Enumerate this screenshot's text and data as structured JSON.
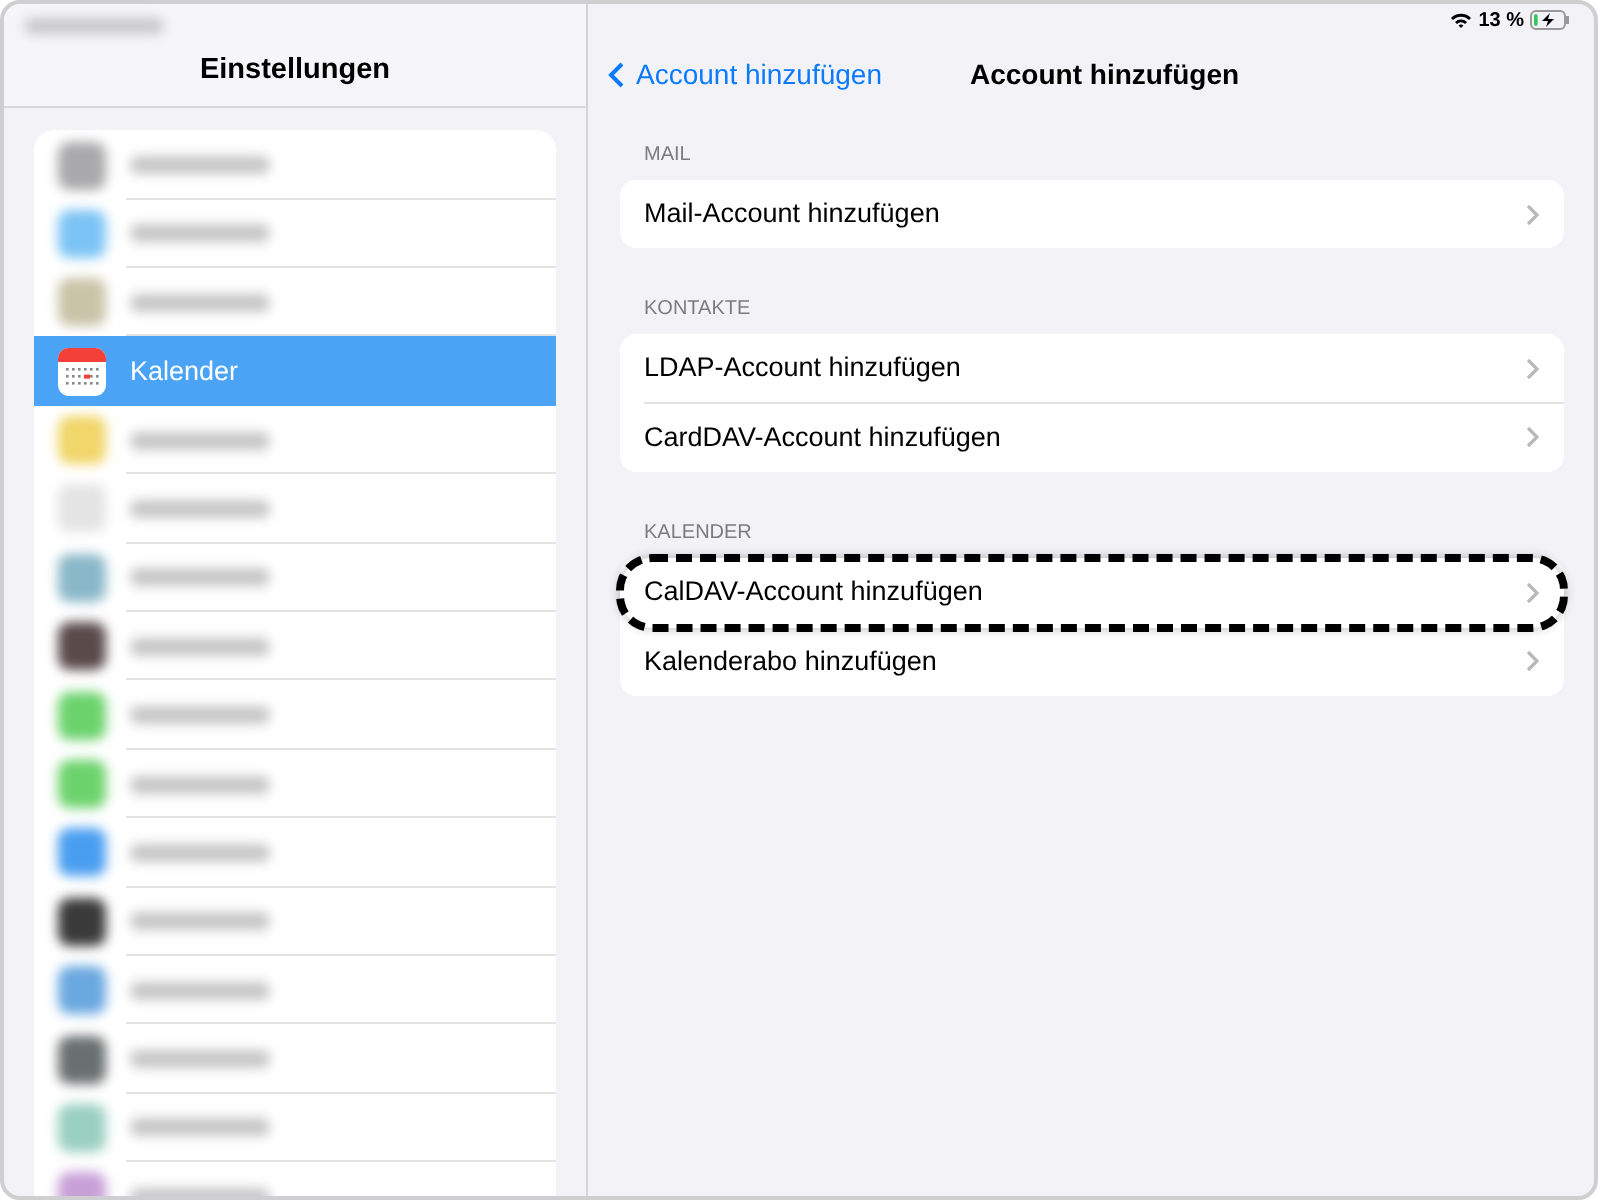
{
  "status_bar": {
    "battery_text": "13 %",
    "charging": true
  },
  "sidebar": {
    "title": "Einstellungen",
    "items": [
      {
        "kind": "blurred",
        "color": "#a9a9ab",
        "selected": false
      },
      {
        "kind": "blurred",
        "color": "#7cc4f5",
        "selected": false
      },
      {
        "kind": "blurred",
        "color": "#c9c4a8",
        "selected": false
      },
      {
        "kind": "calendar",
        "label": "Kalender",
        "selected": true
      },
      {
        "kind": "blurred",
        "color": "#f1d66a",
        "selected": false
      },
      {
        "kind": "blurred",
        "color": "#e4e4e4",
        "selected": false
      },
      {
        "kind": "blurred",
        "color": "#8ab8c8",
        "selected": false
      },
      {
        "kind": "blurred",
        "color": "#5a4a4a",
        "selected": false
      },
      {
        "kind": "blurred",
        "color": "#6cd36c",
        "selected": false
      },
      {
        "kind": "blurred",
        "color": "#6cd36c",
        "selected": false
      },
      {
        "kind": "blurred",
        "color": "#4a9ef0",
        "selected": false
      },
      {
        "kind": "blurred",
        "color": "#3a3a3a",
        "selected": false
      },
      {
        "kind": "blurred",
        "color": "#6aa8e0",
        "selected": false
      },
      {
        "kind": "blurred",
        "color": "#6a7070",
        "selected": false
      },
      {
        "kind": "blurred",
        "color": "#9ad0c0",
        "selected": false
      },
      {
        "kind": "blurred",
        "color": "#c8a0d8",
        "selected": false
      }
    ]
  },
  "detail": {
    "back": "Account hinzufügen",
    "title": "Account hinzufügen",
    "sections": [
      {
        "header": "MAIL",
        "rows": [
          {
            "label": "Mail-Account hinzufügen",
            "highlighted": false
          }
        ]
      },
      {
        "header": "KONTAKTE",
        "rows": [
          {
            "label": "LDAP-Account hinzufügen",
            "highlighted": false
          },
          {
            "label": "CardDAV-Account hinzufügen",
            "highlighted": false
          }
        ]
      },
      {
        "header": "KALENDER",
        "rows": [
          {
            "label": "CalDAV-Account hinzufügen",
            "highlighted": true
          },
          {
            "label": "Kalenderabo hinzufügen",
            "highlighted": false
          }
        ]
      }
    ]
  }
}
